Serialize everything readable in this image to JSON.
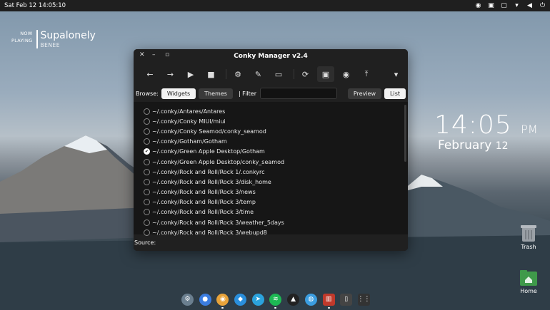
{
  "topbar": {
    "datetime": "Sat Feb 12  14:05:10",
    "tray_icons": [
      "chrome-icon",
      "conky-icon",
      "clipboard-icon",
      "wifi-icon",
      "volume-icon",
      "power-icon"
    ]
  },
  "now_playing": {
    "label_line1": "NOW",
    "label_line2": "PLAYING",
    "title": "Supalonely",
    "artist": "BENEE"
  },
  "desktop_clock": {
    "time": "14:05",
    "ampm": "PM",
    "month": "February",
    "day": "12"
  },
  "desktop_icons": {
    "trash": "Trash",
    "home": "Home"
  },
  "window": {
    "title": "Conky Manager v2.4",
    "toolbar": [
      "back-icon",
      "forward-icon",
      "play-icon",
      "stop-icon",
      "separator",
      "edit-config-icon",
      "edit-icon",
      "folder-icon",
      "separator",
      "refresh-icon",
      "preview-image-icon",
      "circle-icon",
      "upload-icon",
      "dropdown-icon"
    ],
    "browse_label": "Browse:",
    "widgets_label": "Widgets",
    "themes_label": "Themes",
    "filter_label": "|  Filter",
    "filter_value": "",
    "preview_label": "Preview",
    "list_label": "List",
    "items": [
      {
        "path": "~/.conky/Antares/Antares",
        "checked": false
      },
      {
        "path": "~/.conky/Conky MIUI/miui",
        "checked": false
      },
      {
        "path": "~/.conky/Conky Seamod/conky_seamod",
        "checked": false
      },
      {
        "path": "~/.conky/Gotham/Gotham",
        "checked": false
      },
      {
        "path": "~/.conky/Green Apple Desktop/Gotham",
        "checked": true
      },
      {
        "path": "~/.conky/Green Apple Desktop/conky_seamod",
        "checked": false
      },
      {
        "path": "~/.conky/Rock and Roll/Rock 1/.conkyrc",
        "checked": false
      },
      {
        "path": "~/.conky/Rock and Roll/Rock 3/disk_home",
        "checked": false
      },
      {
        "path": "~/.conky/Rock and Roll/Rock 3/news",
        "checked": false
      },
      {
        "path": "~/.conky/Rock and Roll/Rock 3/temp",
        "checked": false
      },
      {
        "path": "~/.conky/Rock and Roll/Rock 3/time",
        "checked": false
      },
      {
        "path": "~/.conky/Rock and Roll/Rock 3/weather_5days",
        "checked": false
      },
      {
        "path": "~/.conky/Rock and Roll/Rock 3/webupd8",
        "checked": false
      }
    ],
    "source_label": "Source:"
  },
  "dock": [
    {
      "icon": "settings-icon",
      "color": "#6b7f8f"
    },
    {
      "icon": "browser-icon",
      "color": "#3b7de0"
    },
    {
      "icon": "chrome-icon",
      "color": "#e8a33a"
    },
    {
      "icon": "vscode-icon",
      "color": "#2a8fdc"
    },
    {
      "icon": "telegram-icon",
      "color": "#2ba3dd"
    },
    {
      "icon": "spotify-icon",
      "color": "#1db954"
    },
    {
      "icon": "inkscape-icon",
      "color": "#222222"
    },
    {
      "icon": "globe-icon",
      "color": "#3b9de0"
    },
    {
      "icon": "system-monitor-icon",
      "color": "#c0392b"
    },
    {
      "icon": "trash-dock-icon",
      "color": "#444444"
    },
    {
      "icon": "app-grid-icon",
      "color": "#333333"
    }
  ]
}
